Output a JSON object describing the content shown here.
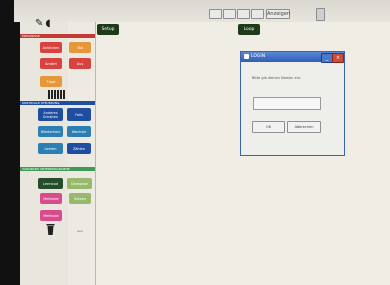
{
  "window": {
    "toolbar": {
      "anzeigen_label": "Anzeigen"
    }
  },
  "palette": {
    "sections": [
      {
        "title": "EREIGNISSE"
      },
      {
        "title": "KONTROLLE   STEUERUNG"
      },
      {
        "title": "VARIABLEN   UNTERPROGRAMME"
      }
    ],
    "event_blocks": [
      "Anklicken",
      "Tab",
      "Ändert",
      "Aus",
      "Tippt"
    ],
    "control_blocks": [
      "Anderes Schalten",
      "Falls",
      "Wiederhole",
      "Wechsle",
      "Leeren",
      "Zählen"
    ],
    "variable_blocks": [
      "Leerstad",
      "Übergabe",
      "Methode",
      "Setzen",
      "Methode"
    ],
    "side_label": "Leer"
  },
  "canvas": {
    "buttons": [
      {
        "label": "Setup"
      },
      {
        "label": "Loop"
      }
    ]
  },
  "dialog": {
    "title": "LOGIN",
    "prompt": "Bitte gib deinen Namen ein:",
    "input_value": "",
    "ok_label": "OK",
    "cancel_label": "Abbrechen",
    "minimize_glyph": "_",
    "close_glyph": "×"
  },
  "colors": {
    "event_red": "#d8433f",
    "event_orange": "#e8963a",
    "control_navy": "#1f4ea1",
    "control_teal": "#2d7fb3",
    "variables_green": "#3f9a55",
    "unterprogramm_pink": "#d84b8c",
    "dialog_titlebar": "#3a63b8",
    "canvas_button": "#1f3a18"
  }
}
